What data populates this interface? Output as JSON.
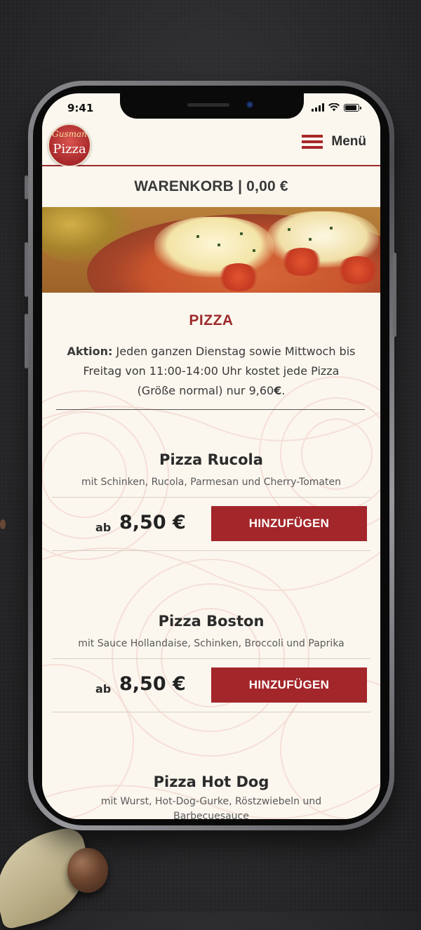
{
  "status_bar": {
    "time": "9:41"
  },
  "header": {
    "logo_script": "Gusman",
    "logo_word": "Pizza",
    "menu_label": "Menü"
  },
  "cart": {
    "label": "WARENKORB | 0,00 €"
  },
  "section": {
    "title": "PIZZA",
    "promo_bold": "Aktion:",
    "promo_text": " Jeden ganzen Dienstag sowie Mittwoch bis Freitag von 11:00-14:00 Uhr kostet jede Pizza (Größe normal) nur 9,60",
    "promo_bold_end": "€",
    "promo_end": "."
  },
  "products": [
    {
      "name": "Pizza Rucola",
      "desc": "mit Schinken, Rucola, Parmesan und Cherry-Tomaten",
      "price_prefix": "ab",
      "price": "8,50 €",
      "button": "HINZUFÜGEN"
    },
    {
      "name": "Pizza Boston",
      "desc": "mit Sauce Hollandaise, Schinken, Broccoli und Paprika",
      "price_prefix": "ab",
      "price": "8,50 €",
      "button": "HINZUFÜGEN"
    },
    {
      "name": "Pizza Hot Dog",
      "desc": "mit Wurst, Hot-Dog-Gurke, Röstzwiebeln und Barbecuesauce"
    }
  ],
  "colors": {
    "accent": "#a3262a",
    "background": "#fbf7ef"
  }
}
